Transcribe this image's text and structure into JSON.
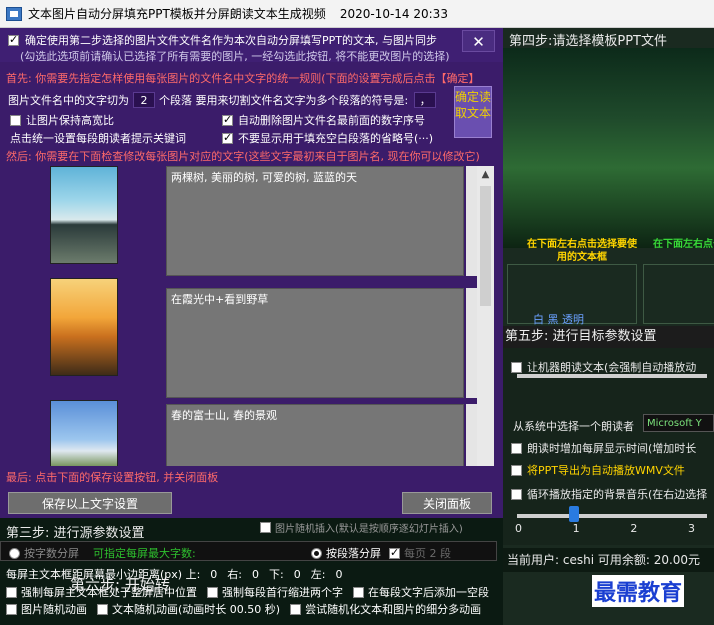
{
  "window": {
    "title": "文本图片自动分屏填充PPT模板并分屏朗读文本生成视频",
    "datetime": "2020-10-14 20:33"
  },
  "dialog": {
    "confirm_label": "确定使用第二步选择的图片文件文件名作为本次自动分屏填写PPT的文本, 与图片同步",
    "confirm_hint": "(勾选此选项前请确认已选择了所有需要的图片, 一经勾选此按钮, 将不能更改图片的选择)",
    "close_label": "✕",
    "first_line": "首先: 你需要先指定怎样使用每张图片的文件名中文字的统一规则(下面的设置完成后点击【确定】",
    "seg_prefix": "图片文件名中的文字切为",
    "seg_value": "2",
    "seg_mid": "个段落  要用来切割文件名文字为多个段落的符号是:",
    "seg_symbol": "，",
    "read_button": "确定读取文本",
    "opt_keep_ratio": "让图片保持高宽比",
    "opt_delete_prefix": "自动删除图片文件名最前面的数字序号",
    "opt_reader_prompt": "点击统一设置每段朗读者提示关键词",
    "opt_no_ellipsis": "不要显示用于填充空白段落的省略号(···)",
    "then_line": "然后: 你需要在下面检查修改每张图片对应的文字(这些文字最初来自于图片名, 现在你可以修改它)",
    "captions": [
      "两棵树, 美丽的树, 可爱的树, 蓝蓝的天",
      "在霞光中+看到野草",
      "春的富士山, 春的景观"
    ],
    "last_line": "最后: 点击下面的保存设置按钮, 并关闭面板",
    "save_button": "保存以上文字设置",
    "close_panel_button": "关闭面板"
  },
  "step3": {
    "title": "第三步: 进行源参数设置",
    "image_random": "图片随机插入(默认是按顺序逐幻灯片插入)",
    "by_word_count": "按字数分屏",
    "max_words_label": "可指定每屏最大字数:",
    "by_paragraph": "按段落分屏",
    "per_screen": "每页 2 段",
    "margin_label": "每屏主文本框距屏幕最小边距离(px) 上:",
    "margin_top": "0",
    "margin_right_label": "右:",
    "margin_right": "0",
    "margin_bottom_label": "下:",
    "margin_bottom": "0",
    "margin_left_label": "左:",
    "margin_left": "0",
    "opt_center": "强制每屏主文本框处于整屏居中位置",
    "opt_indent": "强制每段首行缩进两个字",
    "opt_blank": "在每段文字后添加一空段",
    "opt_img_anim": "图片随机动画",
    "opt_text_anim": "文本随机动画(动画时长 00.50 秒)",
    "opt_fine_anim": "尝试随机化文本和图片的细分多动画"
  },
  "step4": {
    "title": "第四步:请选择模板PPT文件",
    "select_hint": "在下面左右点击选择要使用的文本框",
    "select_hint2": "在下面左右点击",
    "colors": "白  黑  透明"
  },
  "step5": {
    "title": "第五步: 进行目标参数设置",
    "opt_read": "让机器朗读文本(会强制自动播放动",
    "voice_label": "从系统中选择一个朗读者",
    "voice_value": "Microsoft Y",
    "opt_extend": "朗读时增加每屏显示时间(增加时长",
    "opt_export": "将PPT导出为自动播放WMV文件",
    "opt_bgm": "循环播放指定的背景音乐(在右边选择",
    "ticks": [
      "0",
      "1",
      "2",
      "3"
    ]
  },
  "status": {
    "user": "当前用户: ceshi  可用余额: 20.00元"
  },
  "step6": {
    "title": "第六步: 开始转"
  },
  "watermark": "最需教育",
  "colors": {
    "dialog_bg": "#3b1c6a",
    "accent_red": "#ff6a6a",
    "accent_green": "#2ec02e",
    "accent_yellow": "#ffd400"
  }
}
